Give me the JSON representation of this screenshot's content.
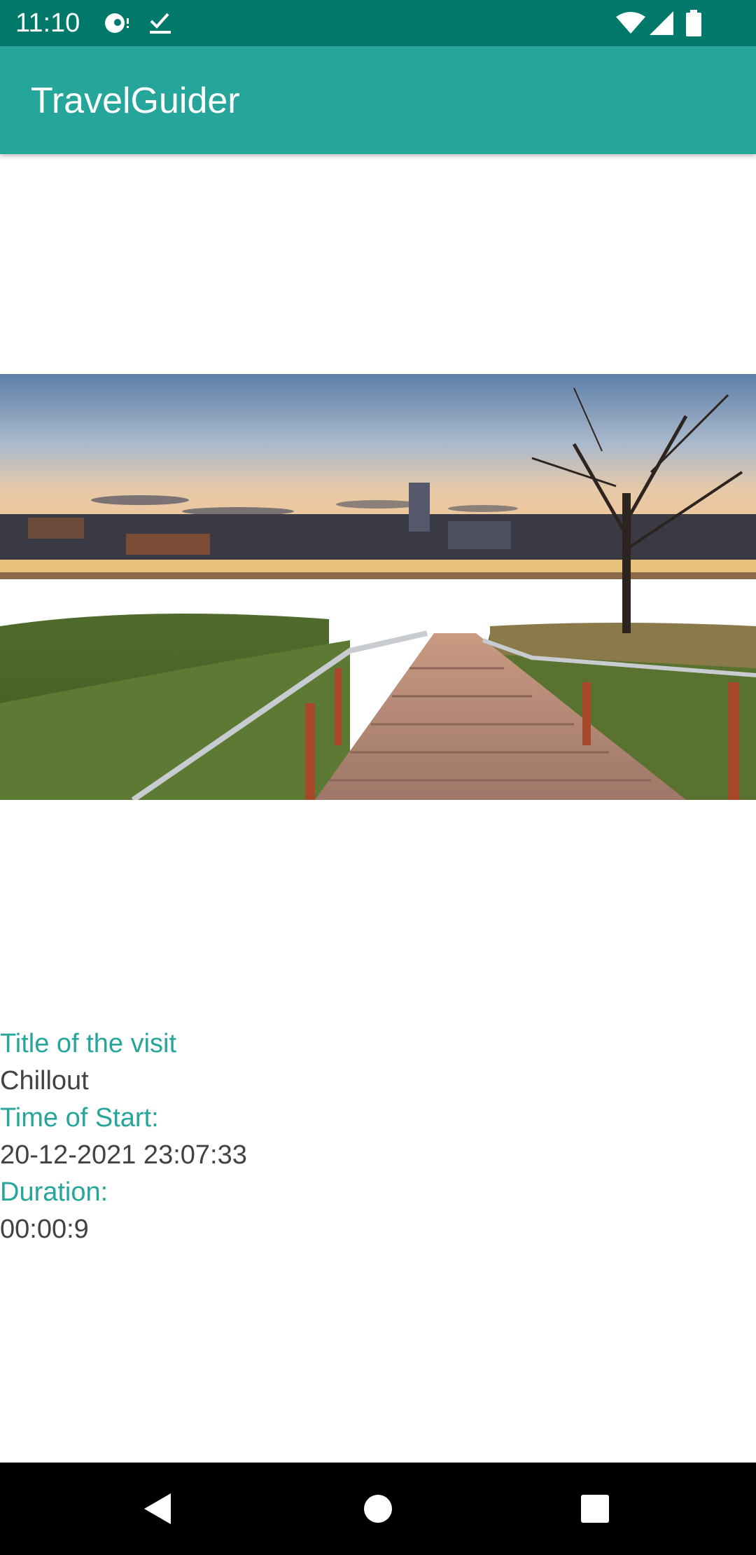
{
  "status_bar": {
    "time": "11:10",
    "icons": [
      "notification-icon",
      "check-icon",
      "wifi-icon",
      "signal-icon",
      "battery-icon"
    ]
  },
  "app_bar": {
    "title": "TravelGuider",
    "color": "#26a69a",
    "status_color": "#00796b"
  },
  "visit_image": {
    "description_icon": "photo-cityscape-stairs"
  },
  "visit": {
    "title_label": "Title of the visit",
    "title_value": "Chillout",
    "start_label": "Time of Start:",
    "start_value": "20-12-2021 23:07:33",
    "duration_label": "Duration:",
    "duration_value": "00:00:9"
  },
  "colors": {
    "label": "#26a69a",
    "value": "#424242"
  },
  "nav_bar": {
    "icons": [
      "back-icon",
      "home-icon",
      "recents-icon"
    ]
  }
}
